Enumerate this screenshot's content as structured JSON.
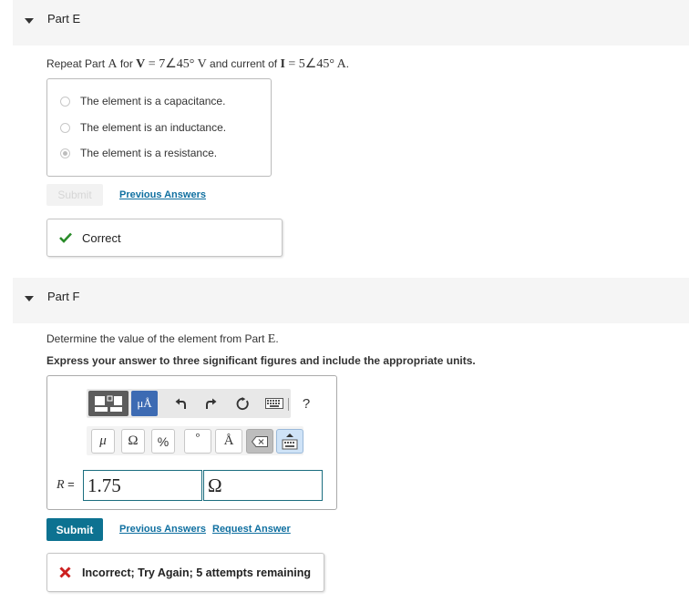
{
  "partE": {
    "title": "Part E",
    "prompt": {
      "t1": "Repeat Part ",
      "partRef": "A",
      "t2": " for ",
      "vSym": "V",
      "vExpr": " = 7∠45° ",
      "vUnit": "V",
      "t3": " and current of ",
      "iSym": "I",
      "iExpr": " = 5∠45° ",
      "iUnit": "A",
      "t4": "."
    },
    "choices": [
      {
        "label": "The element is a capacitance.",
        "selected": false
      },
      {
        "label": "The element is an inductance.",
        "selected": false
      },
      {
        "label": "The element is a resistance.",
        "selected": true
      }
    ],
    "submit_label": "Submit",
    "previous_answers": "Previous Answers",
    "feedback": "Correct",
    "feedback_color": "#2a8c2a"
  },
  "partF": {
    "title": "Part F",
    "prompt": {
      "t1": "Determine the value of the element from Part ",
      "partRef": "E",
      "t2": "."
    },
    "instruction": "Express your answer to three significant figures and include the appropriate units.",
    "toolbar": {
      "template_icon": "templates-icon",
      "units_label": "μÅ",
      "undo_icon": "undo-icon",
      "redo_icon": "redo-icon",
      "reset_icon": "reset-icon",
      "keyboard_icon": "keyboard-icon",
      "help_label": "?",
      "keys": [
        "μ",
        "Ω",
        "%",
        "°",
        "Å"
      ],
      "backspace_icon": "backspace-icon",
      "keypad_icon": "keypad-icon"
    },
    "var_label": "R",
    "equals": " =",
    "value": "1.75",
    "unit": "Ω",
    "submit_label": "Submit",
    "previous_answers": "Previous Answers",
    "request_answer": "Request Answer",
    "feedback": "Incorrect; Try Again; 5 attempts remaining",
    "feedback_color": "#cc1f1f",
    "accent_color": "#0d7291"
  }
}
